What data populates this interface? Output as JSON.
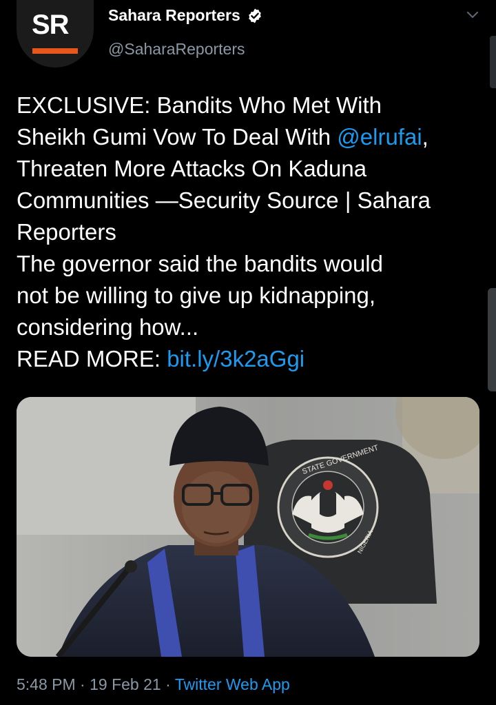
{
  "tweet": {
    "author": {
      "display_name": "Sahara Reporters",
      "handle": "@SaharaReporters",
      "verified": true,
      "avatar_logo_text": "SR",
      "avatar_accent_color": "#e8561c"
    },
    "text_lines": [
      {
        "pre": "EXCLUSIVE: Bandits Who Met With",
        "link": "",
        "post": ""
      },
      {
        "pre": "Sheikh Gumi Vow To Deal With ",
        "link": "@elrufai",
        "post": ","
      },
      {
        "pre": "Threaten More Attacks On Kaduna",
        "link": "",
        "post": ""
      },
      {
        "pre": "Communities —Security Source | Sahara",
        "link": "",
        "post": ""
      },
      {
        "pre": "Reporters",
        "link": "",
        "post": ""
      },
      {
        "pre": "The governor said the bandits would",
        "link": "",
        "post": ""
      },
      {
        "pre": "not be willing to give up kidnapping,",
        "link": "",
        "post": ""
      },
      {
        "pre": "considering how...",
        "link": "",
        "post": ""
      },
      {
        "pre": "READ MORE: ",
        "link": "bit.ly/3k2aGgi",
        "post": ""
      }
    ],
    "media": {
      "seal_text": "STATE GOVERNMENT",
      "seal_text_2": "NIGERIA"
    },
    "time": "5:48 PM",
    "separator": "·",
    "date": "19 Feb 21",
    "source": "Twitter Web App"
  },
  "icons": {
    "verified": "verified-badge-icon",
    "menu": "chevron-down-icon"
  },
  "colors": {
    "background": "#000000",
    "text": "#ffffff",
    "secondary_text": "#8b98a5",
    "link": "#1d9bf0"
  }
}
